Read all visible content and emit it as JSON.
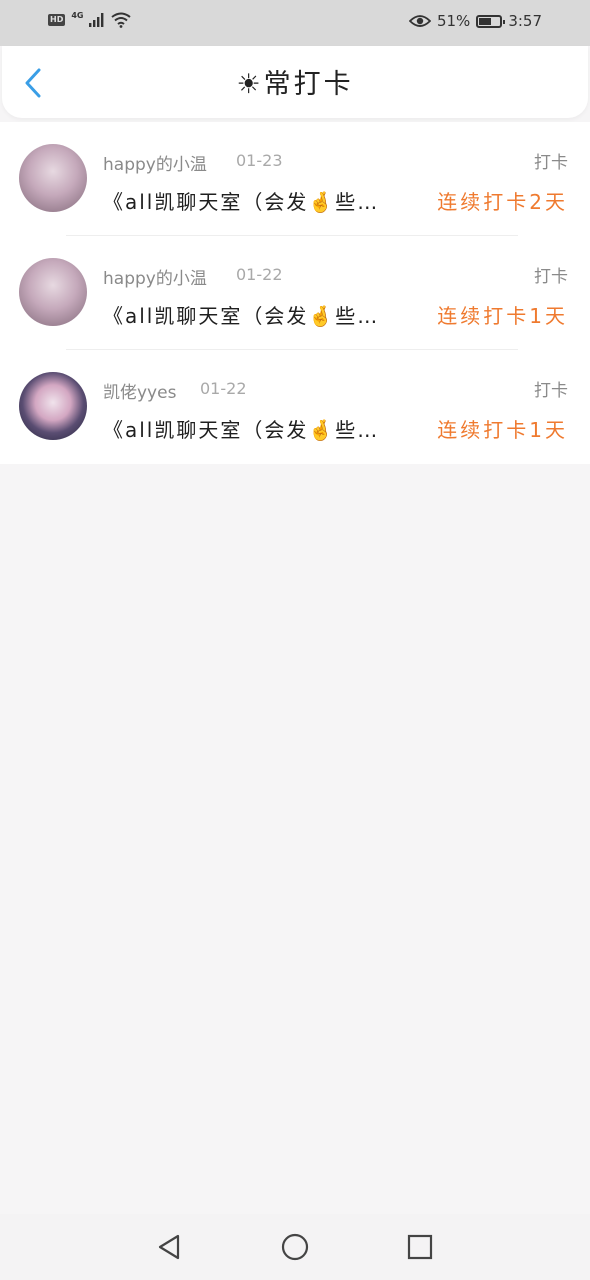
{
  "status_bar": {
    "hd": "HD",
    "network": "4G",
    "battery_percent": "51%",
    "battery_level": 0.51,
    "time": "3:57"
  },
  "header": {
    "title": "☀常打卡",
    "back_icon": "chevron-left-icon"
  },
  "colors": {
    "accent_blue": "#3a9ee6",
    "streak_orange": "#ef7a2f"
  },
  "checkins": [
    {
      "username": "happy的小温",
      "date": "01-23",
      "type": "打卡",
      "group": "《all凯聊天室（会发🤞些…",
      "streak": "连续打卡2天"
    },
    {
      "username": "happy的小温",
      "date": "01-22",
      "type": "打卡",
      "group": "《all凯聊天室（会发🤞些…",
      "streak": "连续打卡1天"
    },
    {
      "username": "凯佬yyes",
      "date": "01-22",
      "type": "打卡",
      "group": "《all凯聊天室（会发🤞些…",
      "streak": "连续打卡1天"
    }
  ],
  "nav": {
    "back": "triangle-back-icon",
    "home": "circle-home-icon",
    "recents": "square-recents-icon"
  }
}
